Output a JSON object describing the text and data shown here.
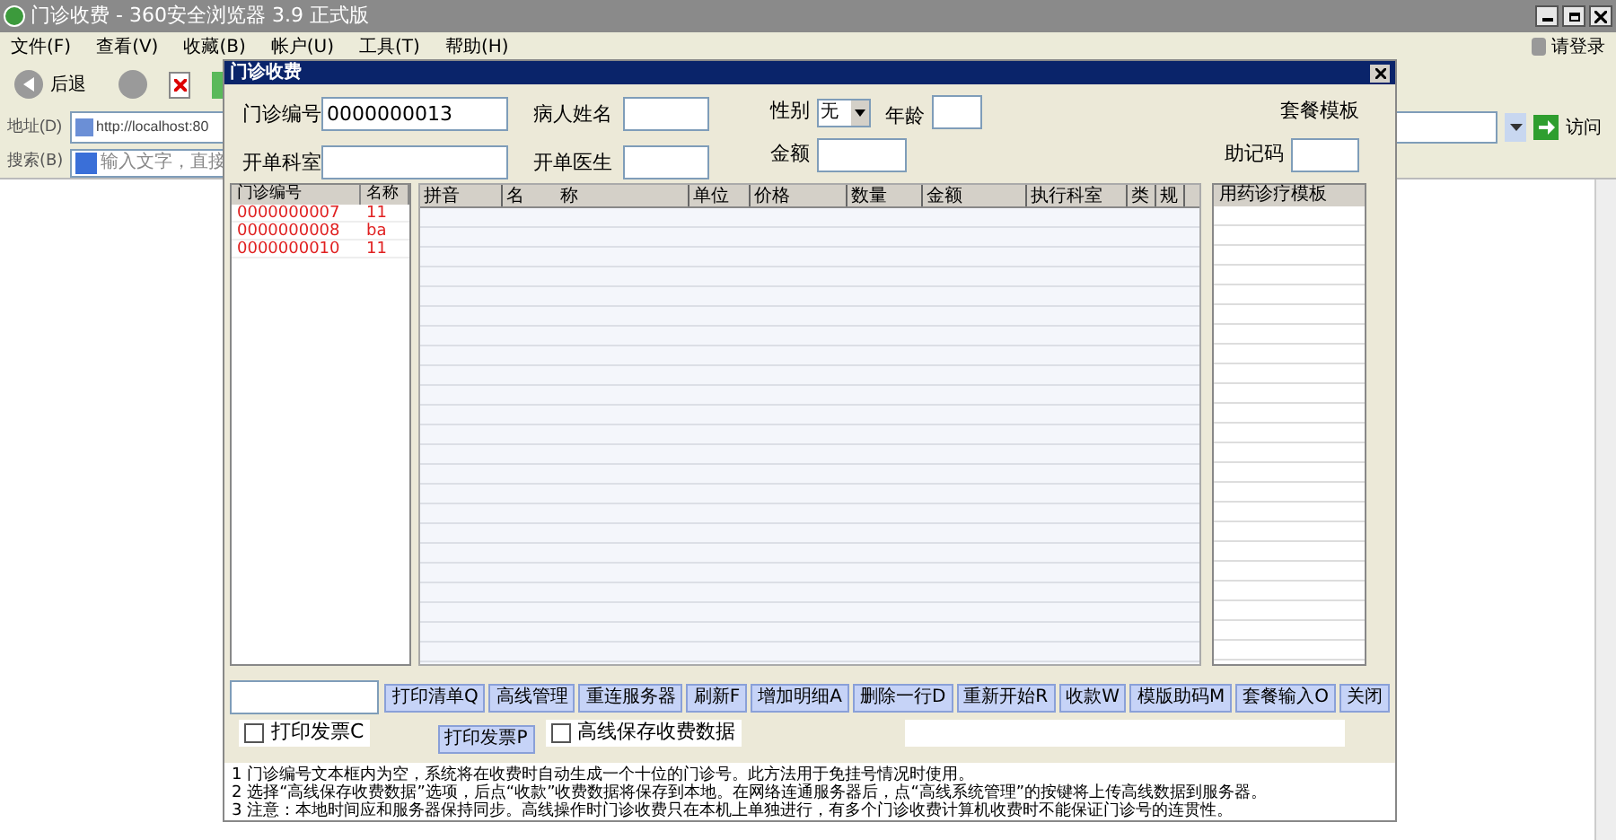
{
  "browser": {
    "title": "门诊收费 - 360安全浏览器 3.9 正式版",
    "menu": [
      "文件(F)",
      "查看(V)",
      "收藏(B)",
      "帐户(U)",
      "工具(T)",
      "帮助(H)"
    ],
    "login": "请登录",
    "back": "后退",
    "address_label": "地址(D)",
    "address": "http://localhost:80",
    "go": "访问",
    "search_label": "搜索(B)",
    "search_placeholder": "输入文字，直接"
  },
  "dialog": {
    "title": "门诊收费",
    "fields": [
      {
        "label": "门诊编号",
        "value": "0000000013"
      },
      {
        "label": "病人姓名"
      },
      {
        "label": "开单科室"
      },
      {
        "label": "开单医生"
      }
    ],
    "gender": {
      "label": "性别",
      "value": "无"
    },
    "age": {
      "label": "年龄"
    },
    "amount": {
      "label": "金额"
    },
    "package_label": "套餐模板",
    "mnemonic": {
      "label": "助记码"
    },
    "list": {
      "columns": [
        "门诊编号",
        "名称"
      ],
      "rows": [
        [
          "0000000007",
          "11"
        ],
        [
          "0000000008",
          "ba"
        ],
        [
          "0000000010",
          "11"
        ]
      ]
    },
    "grid": {
      "columns": [
        "拼音",
        "名　　称",
        "单位",
        "价格",
        "数量",
        "金额",
        "执行科室",
        "类",
        "规"
      ]
    },
    "templates": {
      "title": "用药诊疗模板"
    },
    "buttons": [
      "打印清单Q",
      "高线管理",
      "重连服务器",
      "刷新F",
      "增加明细A",
      "删除一行D",
      "重新开始R",
      "收款W",
      "模版助码M",
      "套餐输入O",
      "关闭"
    ],
    "print_invoice_button": "打印发票P",
    "checkboxes": [
      {
        "label": "打印发票C",
        "checked": false
      },
      {
        "label": "高线保存收费数据",
        "checked": false
      }
    ],
    "notes": [
      "1 门诊编号文本框内为空，系统将在收费时自动生成一个十位的门诊号。此方法用于免挂号情况时使用。",
      "2 选择“高线保存收费数据”选项，后点“收款”收费数据将保存到本地。在网络连通服务器后，点“高线系统管理”的按键将上传高线数据到服务器。",
      "3 注意：本地时间应和服务器保持同步。高线操作时门诊收费只在本机上单独进行，有多个门诊收费计算机收费时不能保证门诊号的连贯性。"
    ]
  }
}
